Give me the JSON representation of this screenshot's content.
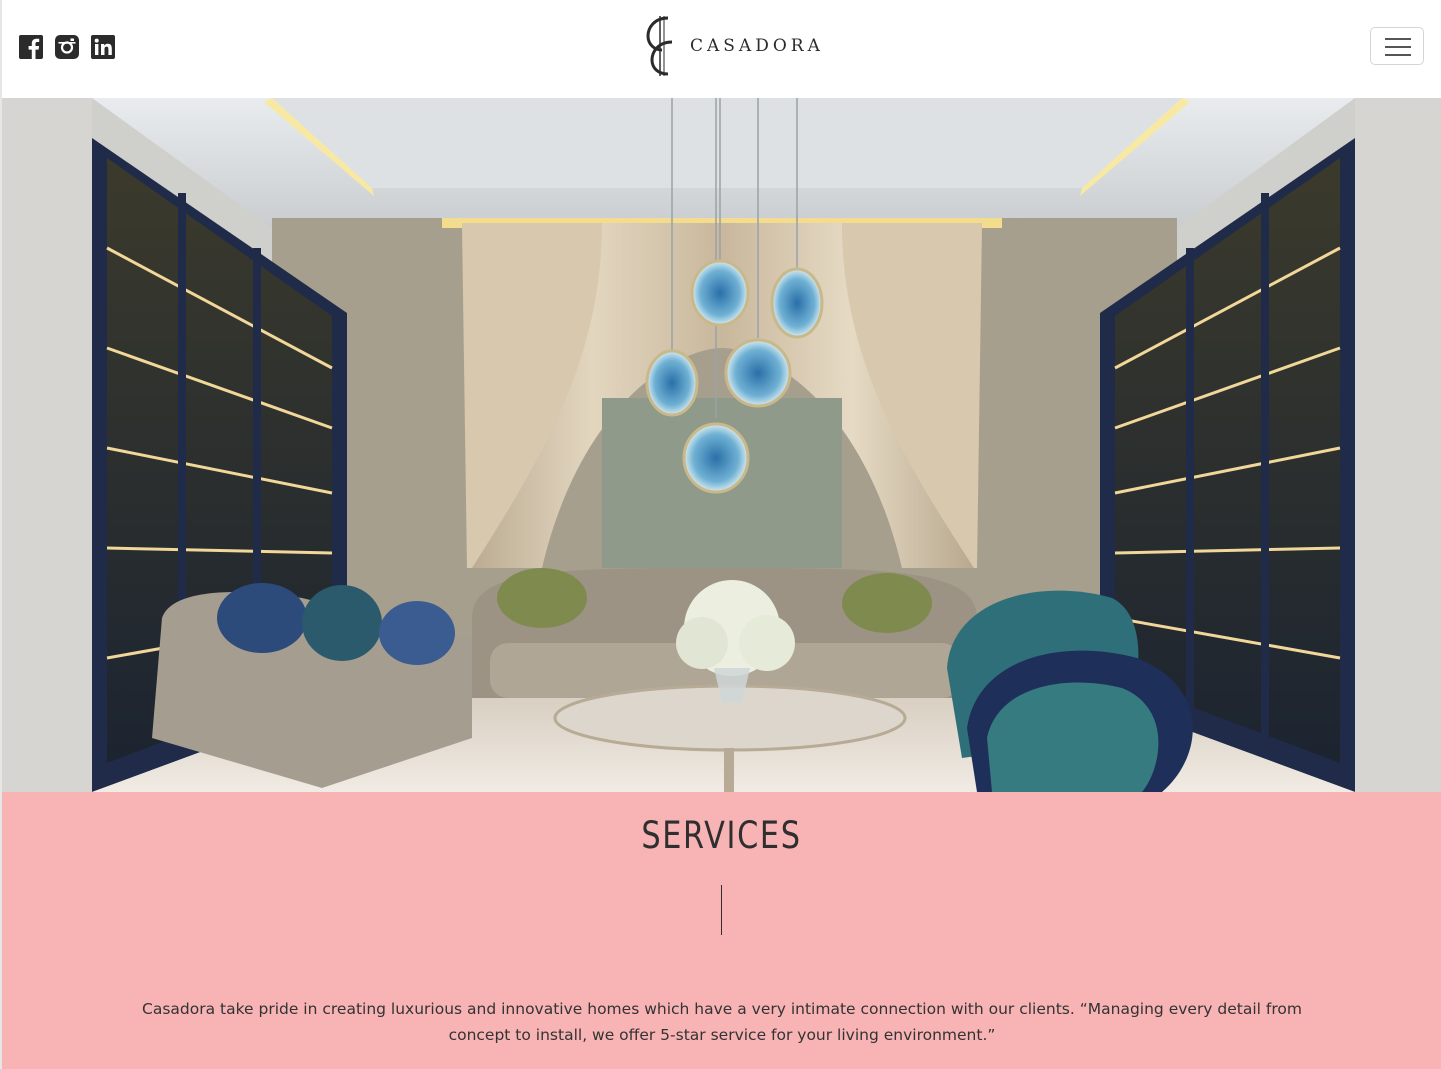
{
  "header": {
    "social": [
      {
        "icon": "facebook-icon"
      },
      {
        "icon": "instagram-icon"
      },
      {
        "icon": "linkedin-icon"
      }
    ],
    "logo_text": "CASADORA",
    "menu_icon": "hamburger-menu-icon"
  },
  "hero": {
    "image": "luxury living room interior with curtains, bookshelves, sofas and pendant lights"
  },
  "services": {
    "title": "SERVICES",
    "description": "Casadora take pride in creating luxurious and innovative homes which have a very intimate connection with our clients. “Managing every detail from concept to install, we offer 5-star service for your living environment.”",
    "background": "#f8b3b5"
  }
}
